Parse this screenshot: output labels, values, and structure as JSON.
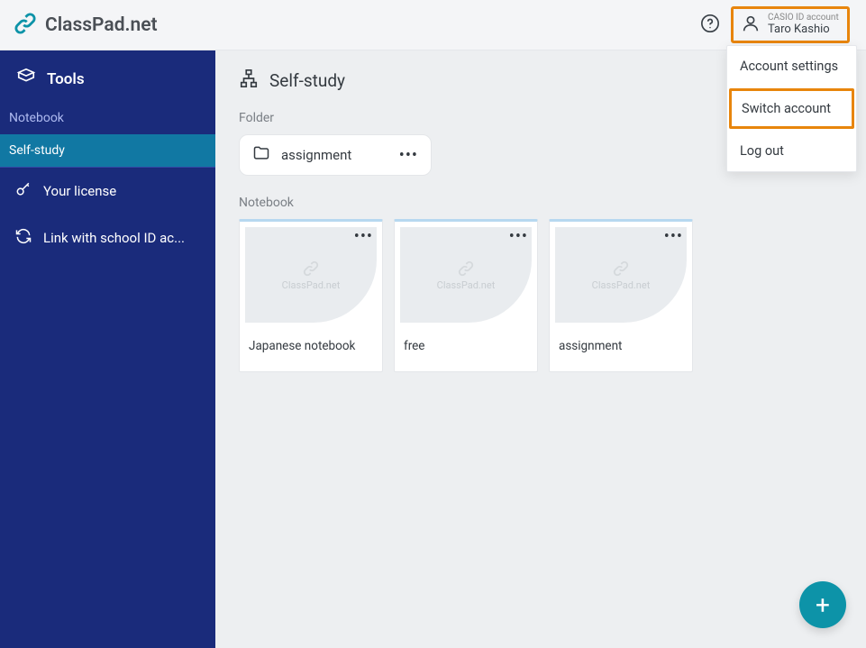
{
  "header": {
    "brand": "ClassPad.net",
    "account_sub": "CASIO ID account",
    "account_name": "Taro Kashio"
  },
  "account_menu": {
    "settings": "Account settings",
    "switch": "Switch account",
    "logout": "Log out"
  },
  "sidebar": {
    "group_label": "Tools",
    "items": [
      {
        "label": "Notebook"
      },
      {
        "label": "Self-study"
      }
    ],
    "links": [
      {
        "label": "Your license"
      },
      {
        "label": "Link with school ID ac..."
      }
    ]
  },
  "main": {
    "page_title": "Self-study",
    "folder_section": "Folder",
    "folder_name": "assignment",
    "notebook_section": "Notebook",
    "watermark": "ClassPad.net",
    "cards": [
      {
        "title": "Japanese notebook"
      },
      {
        "title": "free"
      },
      {
        "title": "assignment"
      }
    ],
    "fab": "+"
  }
}
